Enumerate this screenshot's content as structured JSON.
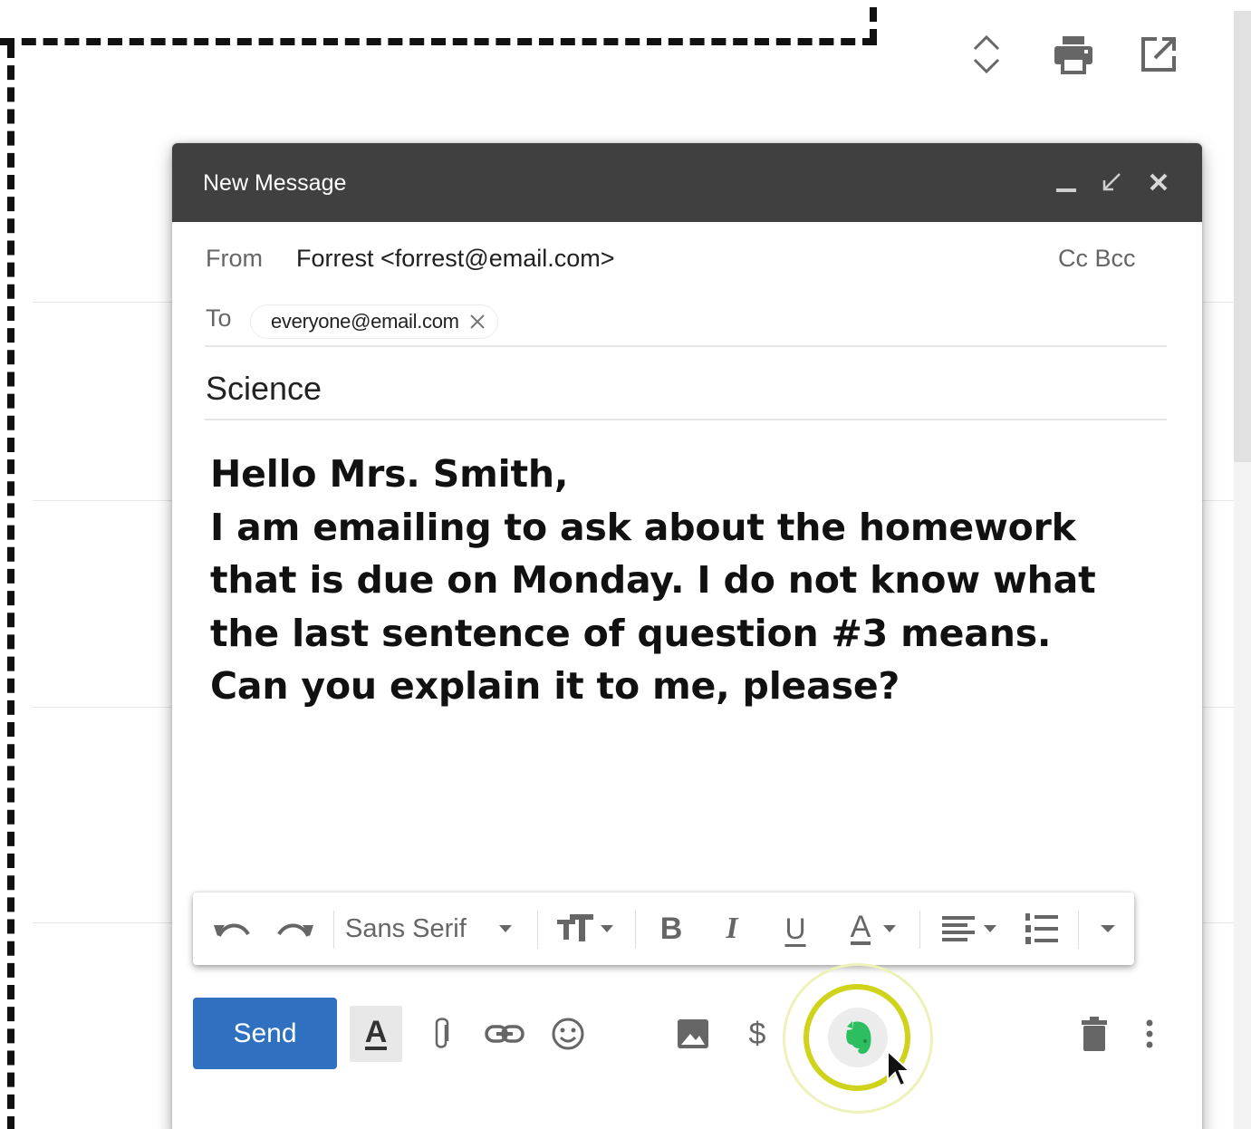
{
  "toolbar_top": {
    "icons": [
      "expand-collapse-icon",
      "print-icon",
      "open-in-new-window-icon"
    ]
  },
  "compose": {
    "title": "New Message",
    "window_controls": [
      "minimize-icon",
      "exit-full-screen-icon",
      "close-icon"
    ],
    "from_label": "From",
    "from_value": "Forrest <forrest@email.com>",
    "cc_bcc": "Cc Bcc",
    "to_label": "To",
    "to_recipient": "everyone@email.com",
    "subject": "Science",
    "body": "Hello Mrs. Smith,\nI am emailing to ask about the homework\nthat is due on Monday. I do not know what\nthe last sentence of  question #3 means.\nCan you explain it to me, please?"
  },
  "formatting": {
    "font_name": "Sans Serif",
    "bold": "B",
    "italic": "I",
    "underline": "U",
    "text_color": "A",
    "icons": [
      "undo-icon",
      "redo-icon",
      "font-dropdown-icon",
      "font-size-icon",
      "bold-icon",
      "italic-icon",
      "underline-icon",
      "text-color-icon",
      "align-icon",
      "numbered-list-icon",
      "more-formatting-icon"
    ]
  },
  "actions": {
    "send_label": "Send",
    "format_toggle": "A",
    "dollar": "$",
    "icons": [
      "formatting-options-icon",
      "attach-icon",
      "link-icon",
      "emoji-icon",
      "photo-icon",
      "send-money-icon",
      "evernote-icon",
      "discard-icon",
      "more-options-icon"
    ]
  },
  "colors": {
    "titlebar": "#404040",
    "send_button": "#2f70c0",
    "highlight_ring": "#cfd319",
    "evernote_green": "#2dbe60"
  }
}
